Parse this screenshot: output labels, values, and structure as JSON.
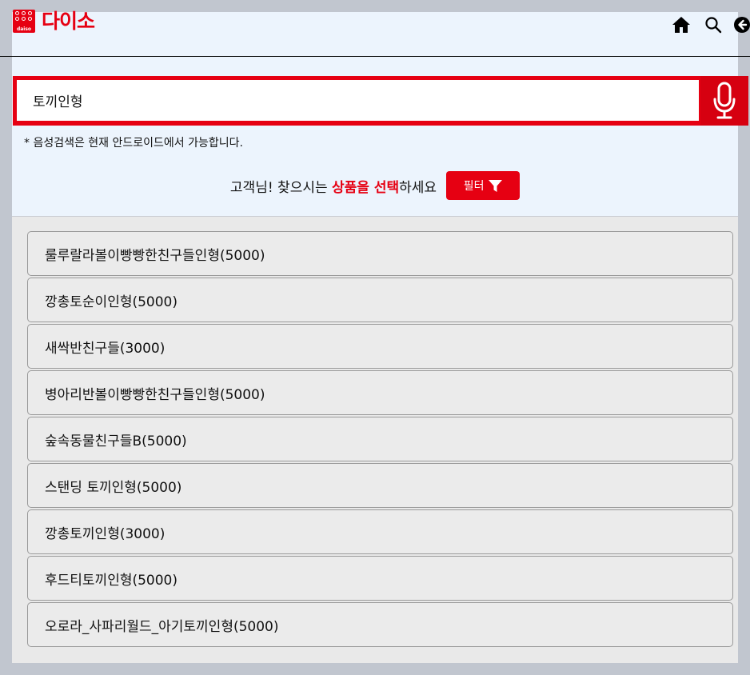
{
  "header": {
    "logo_small": "daiso",
    "logo_text": "다이소",
    "icons": [
      "home-icon",
      "search-icon",
      "back-icon"
    ]
  },
  "search": {
    "value": "토끼인형",
    "mic_icon": "microphone-icon"
  },
  "voice_note": "* 음성검색은 현재 안드로이드에서 가능합니다.",
  "prompt": {
    "prefix": "고객님! 찾으시는 ",
    "highlight": "상품을 선택",
    "suffix": "하세요"
  },
  "filter": {
    "label": "필터",
    "icon": "funnel-icon"
  },
  "results": [
    "룰루랄라볼이빵빵한친구들인형(5000)",
    "깡총토순이인형(5000)",
    "새싹반친구들(3000)",
    "병아리반볼이빵빵한친구들인형(5000)",
    "숲속동물친구들B(5000)",
    "스탠딩 토끼인형(5000)",
    "깡총토끼인형(3000)",
    "후드티토끼인형(5000)",
    "오로라_사파리월드_아기토끼인형(5000)"
  ],
  "colors": {
    "brand_red": "#e60012",
    "page_bg": "#ecf4fd",
    "outer_bg": "#c1c6cf"
  }
}
